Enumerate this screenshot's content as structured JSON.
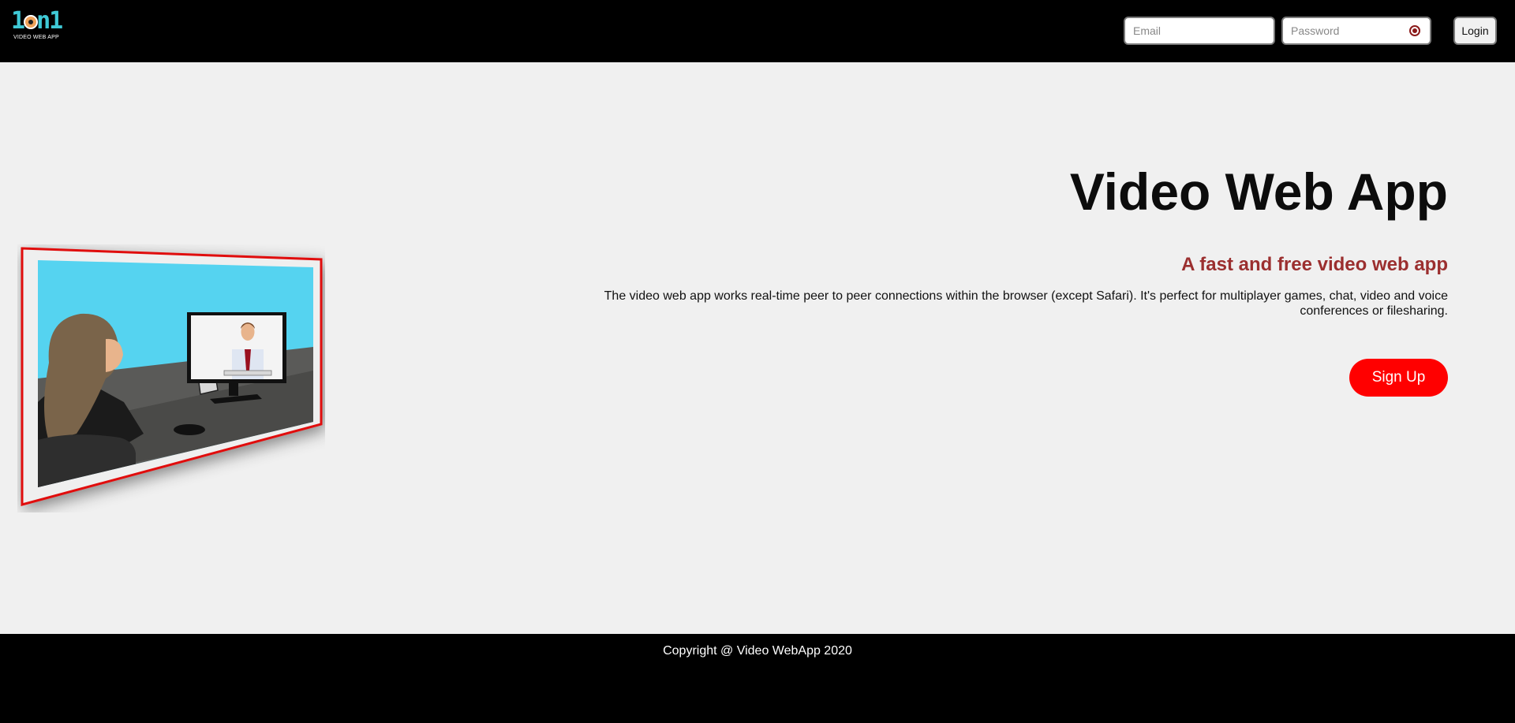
{
  "header": {
    "logo": {
      "digits": "1on1",
      "tagline": "VIDEO WEB APP"
    },
    "email": {
      "placeholder": "Email",
      "value": ""
    },
    "password": {
      "placeholder": "Password",
      "value": ""
    },
    "login_label": "Login"
  },
  "hero": {
    "title": "Video Web App",
    "subtitle": "A fast and free video web app",
    "description": "The video web app works real-time peer to peer connections within the browser (except Safari). It's perfect for multiplayer games, chat, video and voice conferences or filesharing.",
    "signup_label": "Sign Up"
  },
  "footer": {
    "copyright": "Copyright @ Video WebApp 2020"
  },
  "colors": {
    "header_bg": "#000000",
    "page_bg": "#f0f0f0",
    "accent_red": "#ff0000",
    "subtitle_color": "#9b2f2f",
    "logo_teal": "#3fc9d6"
  }
}
